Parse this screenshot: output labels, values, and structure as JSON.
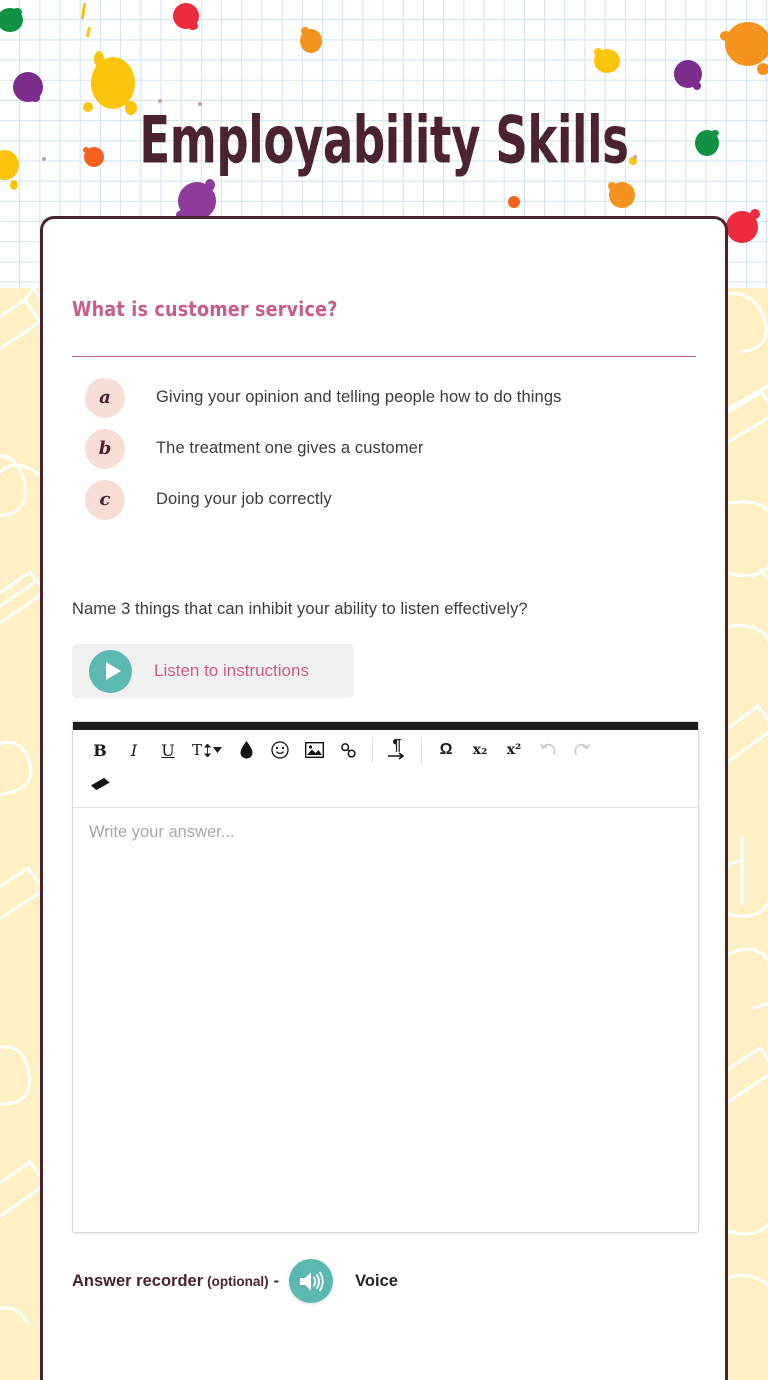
{
  "page": {
    "title": "Employability Skills",
    "accent_maroon": "#4a2232",
    "accent_pink": "#c75d8a",
    "accent_teal": "#5cb9b2",
    "bubble_pink": "#f7ded7",
    "side_cream": "#fdf0c4"
  },
  "question1": {
    "prompt": "What is customer service?",
    "options": [
      {
        "letter": "a",
        "text": "Giving your opinion and telling people how to do things"
      },
      {
        "letter": "b",
        "text": "The treatment one gives a customer"
      },
      {
        "letter": "c",
        "text": "Doing your job correctly"
      }
    ]
  },
  "question2": {
    "prompt": "Name 3 things that can inhibit your ability to listen effectively?",
    "listen_button": {
      "label": "Listen to instructions",
      "icon": "play-icon"
    },
    "editor": {
      "placeholder": "Write your answer...",
      "value": "",
      "toolbar": [
        {
          "name": "bold-button",
          "label": "B"
        },
        {
          "name": "italic-button",
          "label": "I"
        },
        {
          "name": "underline-button",
          "label": "U"
        },
        {
          "name": "font-size-button",
          "label": "T"
        },
        {
          "name": "text-color-button",
          "label": "⬤"
        },
        {
          "name": "emoji-button",
          "label": "☺"
        },
        {
          "name": "insert-image-button",
          "label": "image"
        },
        {
          "name": "insert-link-button",
          "label": "link"
        },
        {
          "name": "text-direction-button",
          "label": "¶"
        },
        {
          "name": "special-character-button",
          "label": "Ω"
        },
        {
          "name": "subscript-button",
          "label": "x₂"
        },
        {
          "name": "superscript-button",
          "label": "x²"
        },
        {
          "name": "undo-button",
          "label": "↺"
        },
        {
          "name": "redo-button",
          "label": "↻"
        },
        {
          "name": "clear-formatting-button",
          "label": "eraser"
        }
      ]
    },
    "recorder": {
      "label": "Answer recorder",
      "optional": "(optional)",
      "dash": "-",
      "voice_label": "Voice",
      "icon": "speaker-icon"
    }
  }
}
